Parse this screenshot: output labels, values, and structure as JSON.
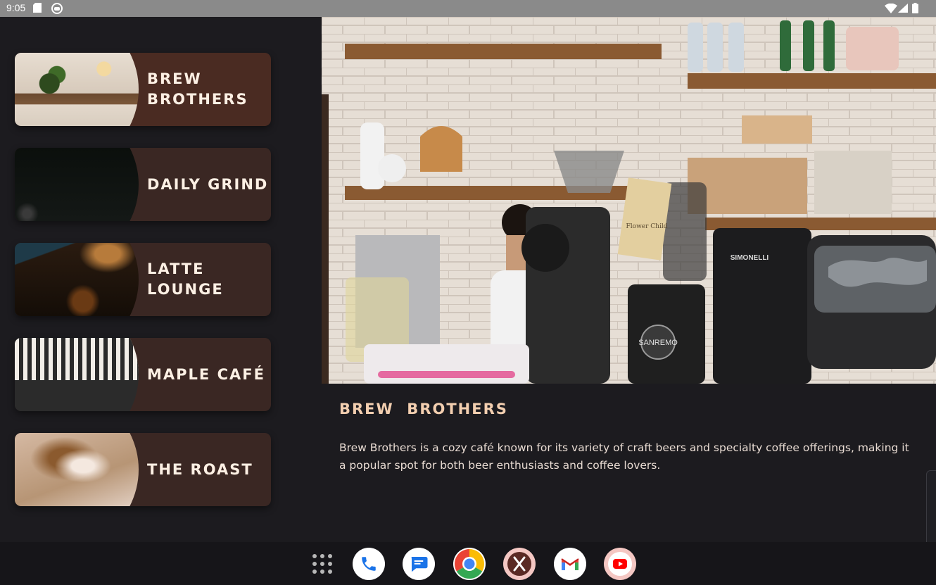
{
  "status_bar": {
    "time": "9:05"
  },
  "cafes": [
    {
      "name": "Brew Brothers",
      "selected": true
    },
    {
      "name": "Daily Grind",
      "selected": false
    },
    {
      "name": "Latte Lounge",
      "selected": false
    },
    {
      "name": "Maple Café",
      "selected": false
    },
    {
      "name": "The Roast",
      "selected": false
    }
  ],
  "detail": {
    "title": "BREW  BROTHERS",
    "description": "Brew Brothers is a cozy café known for its variety of craft beers and specialty coffee offerings, making it a popular spot for both beer enthusiasts and coffee lovers.",
    "hero_image_text": {
      "grinder_brand": "SANREMO",
      "machine_brand": "SIMONELLI",
      "bag_label": "Flower Child"
    }
  },
  "colors": {
    "background": "#1c1b1f",
    "card": "#3a2723",
    "card_selected": "#4a2b22",
    "title_accent": "#f3cfb0",
    "body_text": "#e9dcd3"
  },
  "taskbar": {
    "apps": [
      "app-drawer-icon",
      "phone-icon",
      "messages-icon",
      "chrome-icon",
      "cafe-app-icon",
      "gmail-icon",
      "youtube-icon"
    ]
  }
}
